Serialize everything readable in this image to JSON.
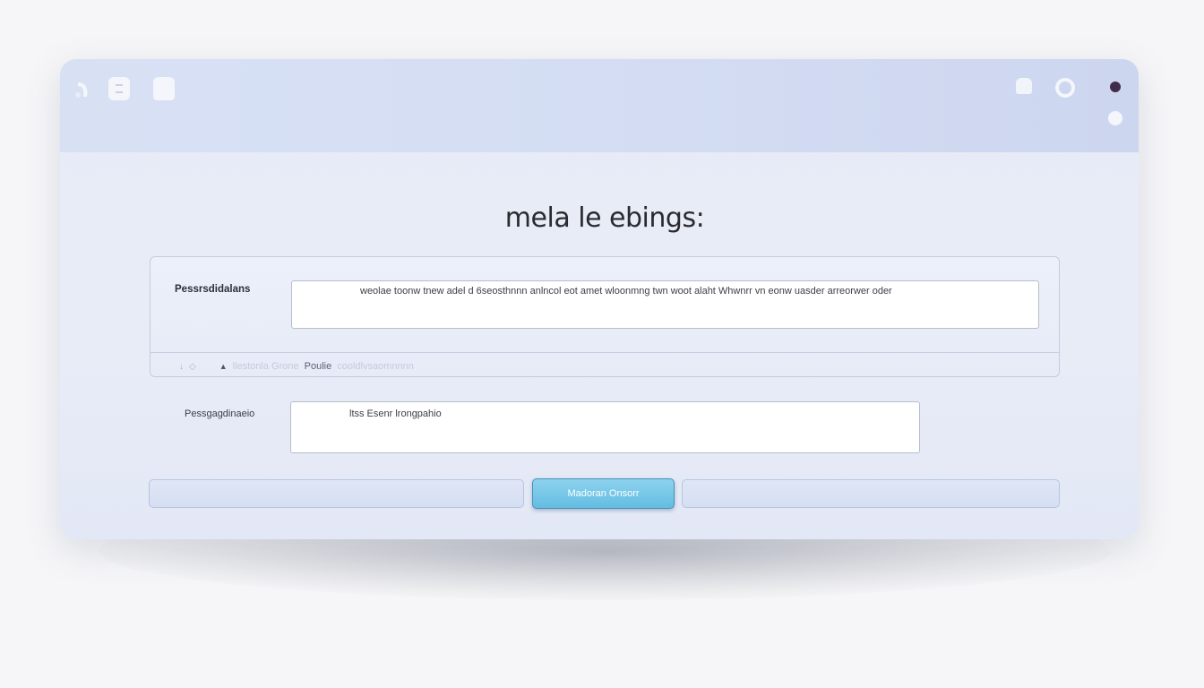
{
  "window": {
    "title": "mela le ebings:",
    "toolbar_icons": [
      "back-icon",
      "document-icon",
      "document-icon",
      "bell-icon",
      "ring-icon",
      "record-icon",
      "circle-icon"
    ]
  },
  "form": {
    "field1": {
      "label": "Pessrsdidalans",
      "value": "weolae toonw tnew adel d 6seosthnnn  anlncol eot amet wloonmng twn woot alaht Whwnrr vn eonw uasder arreorwer oder"
    },
    "hint": {
      "text_a": "llestonla Grone",
      "text_b": "Poulie",
      "text_c": "cooldlvsaomnnnn"
    },
    "field2": {
      "label": "Pessgagdinaeio",
      "value": "ltss Esenr lrongpahio"
    },
    "primary_button": "Madoran Onsorr"
  },
  "colors": {
    "accent": "#63bde2",
    "titlebar": "#d6def3",
    "background": "#e8ecf7"
  }
}
